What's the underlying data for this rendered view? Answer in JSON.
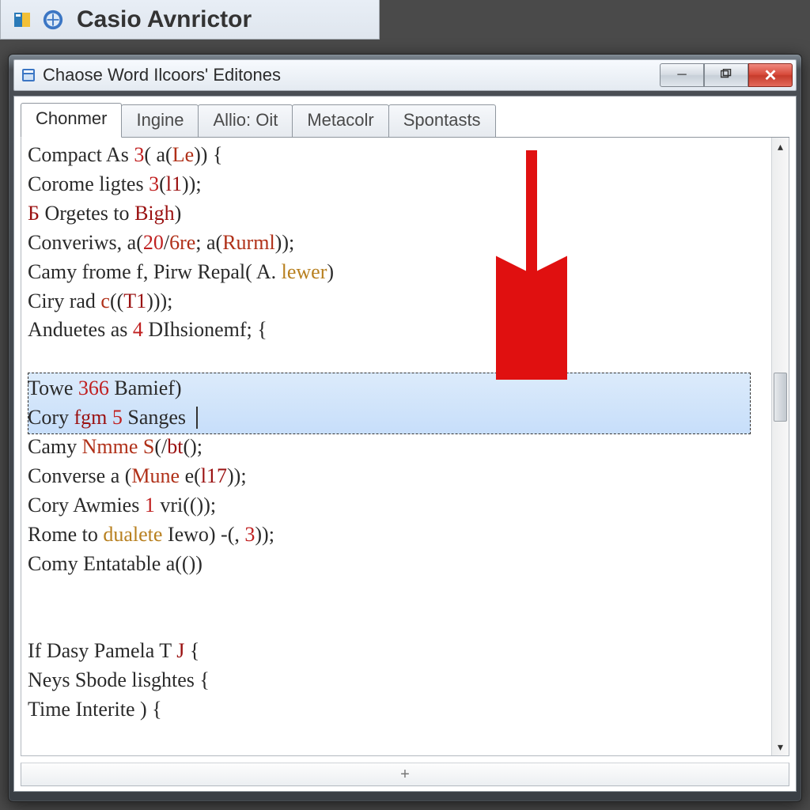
{
  "taskbar": {
    "app_title": "Casio Avnrictor"
  },
  "window": {
    "title": "Chaose Word Ilcoors' Editones"
  },
  "tabs": [
    {
      "label": "Chonmer",
      "active": true
    },
    {
      "label": "Ingine",
      "active": false
    },
    {
      "label": "Allio: Oit",
      "active": false
    },
    {
      "label": "Metacolr",
      "active": false
    },
    {
      "label": "Spontasts",
      "active": false
    }
  ],
  "code": {
    "lines": [
      {
        "segments": [
          {
            "t": "Compact As "
          },
          {
            "t": "3",
            "c": "tok-num"
          },
          {
            "t": "( a("
          },
          {
            "t": "Le",
            "c": "tok-fn"
          },
          {
            "t": ")) {"
          }
        ]
      },
      {
        "segments": [
          {
            "t": "Corome ligtes "
          },
          {
            "t": "3",
            "c": "tok-num"
          },
          {
            "t": "("
          },
          {
            "t": "l1",
            "c": "tok-kw"
          },
          {
            "t": "));"
          }
        ]
      },
      {
        "segments": [
          {
            "t": "Б",
            "c": "tok-kw"
          },
          {
            "t": " Orgetes to "
          },
          {
            "t": "Bigh",
            "c": "tok-kw"
          },
          {
            "t": ")"
          }
        ]
      },
      {
        "segments": [
          {
            "t": "Converiws, a("
          },
          {
            "t": "20",
            "c": "tok-num"
          },
          {
            "t": "/"
          },
          {
            "t": "6re",
            "c": "tok-fn"
          },
          {
            "t": "; a("
          },
          {
            "t": "Rurml",
            "c": "tok-fn"
          },
          {
            "t": "));"
          }
        ]
      },
      {
        "segments": [
          {
            "t": "Camy frome f, Pirw Repal( A. "
          },
          {
            "t": "lewer",
            "c": "tok-hl"
          },
          {
            "t": ")"
          }
        ]
      },
      {
        "segments": [
          {
            "t": "Ciry rad "
          },
          {
            "t": "c",
            "c": "tok-fn"
          },
          {
            "t": "(("
          },
          {
            "t": "T1",
            "c": "tok-kw"
          },
          {
            "t": ")));"
          }
        ]
      },
      {
        "segments": [
          {
            "t": "Anduetes as "
          },
          {
            "t": "4",
            "c": "tok-num"
          },
          {
            "t": " DIhsionemf; {"
          }
        ]
      },
      {
        "segments": [
          {
            "t": ""
          }
        ]
      },
      {
        "segments": [
          {
            "t": "Towe "
          },
          {
            "t": "366",
            "c": "tok-num"
          },
          {
            "t": " Bamief)"
          }
        ],
        "selected": true
      },
      {
        "segments": [
          {
            "t": "Cory "
          },
          {
            "t": "fgm",
            "c": "tok-kw"
          },
          {
            "t": " "
          },
          {
            "t": "5",
            "c": "tok-num"
          },
          {
            "t": " Sanges "
          }
        ],
        "selected": true,
        "cursor": true
      },
      {
        "segments": [
          {
            "t": "Camy "
          },
          {
            "t": "Nmme",
            "c": "tok-fn"
          },
          {
            "t": " "
          },
          {
            "t": "S",
            "c": "tok-fn"
          },
          {
            "t": "(/"
          },
          {
            "t": "bt",
            "c": "tok-kw"
          },
          {
            "t": "();"
          }
        ]
      },
      {
        "segments": [
          {
            "t": "Converse a ("
          },
          {
            "t": "Mune",
            "c": "tok-fn"
          },
          {
            "t": " e("
          },
          {
            "t": "l17",
            "c": "tok-kw"
          },
          {
            "t": "));"
          }
        ]
      },
      {
        "segments": [
          {
            "t": "Cory Awmies "
          },
          {
            "t": "1",
            "c": "tok-num"
          },
          {
            "t": " vri(());"
          }
        ]
      },
      {
        "segments": [
          {
            "t": "Rome to "
          },
          {
            "t": "dualete",
            "c": "tok-hl"
          },
          {
            "t": " Iewo) -(, "
          },
          {
            "t": "3",
            "c": "tok-num"
          },
          {
            "t": "));"
          }
        ]
      },
      {
        "segments": [
          {
            "t": "Comy Entatable a(())"
          }
        ]
      },
      {
        "segments": [
          {
            "t": ""
          }
        ]
      },
      {
        "segments": [
          {
            "t": ""
          }
        ]
      },
      {
        "segments": [
          {
            "t": "If Dasy Pamela T "
          },
          {
            "t": "J",
            "c": "tok-kw"
          },
          {
            "t": " {"
          }
        ]
      },
      {
        "segments": [
          {
            "t": "Neys Sbode lisghtes {"
          }
        ]
      },
      {
        "segments": [
          {
            "t": "Time Interite ) {"
          }
        ]
      }
    ]
  },
  "statusbar": {
    "plus": "+"
  },
  "scrollbar": {
    "thumb_top_pct": 38,
    "thumb_height_pct": 8
  }
}
